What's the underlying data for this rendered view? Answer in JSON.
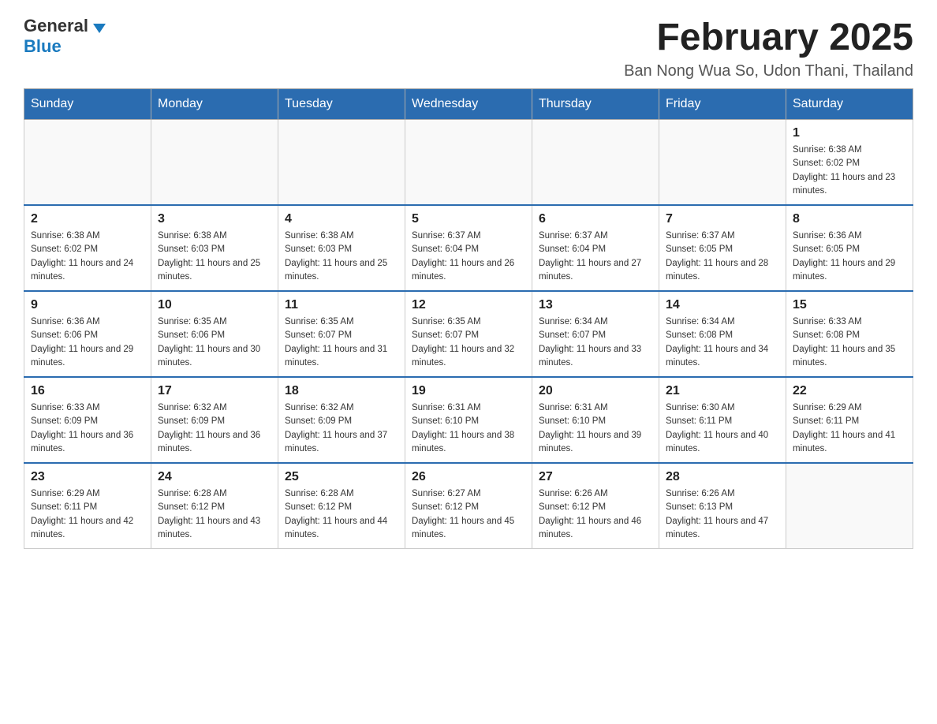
{
  "header": {
    "logo_general": "General",
    "logo_blue": "Blue",
    "month_year": "February 2025",
    "location": "Ban Nong Wua So, Udon Thani, Thailand"
  },
  "weekdays": [
    "Sunday",
    "Monday",
    "Tuesday",
    "Wednesday",
    "Thursday",
    "Friday",
    "Saturday"
  ],
  "weeks": [
    [
      {
        "day": "",
        "sunrise": "",
        "sunset": "",
        "daylight": ""
      },
      {
        "day": "",
        "sunrise": "",
        "sunset": "",
        "daylight": ""
      },
      {
        "day": "",
        "sunrise": "",
        "sunset": "",
        "daylight": ""
      },
      {
        "day": "",
        "sunrise": "",
        "sunset": "",
        "daylight": ""
      },
      {
        "day": "",
        "sunrise": "",
        "sunset": "",
        "daylight": ""
      },
      {
        "day": "",
        "sunrise": "",
        "sunset": "",
        "daylight": ""
      },
      {
        "day": "1",
        "sunrise": "Sunrise: 6:38 AM",
        "sunset": "Sunset: 6:02 PM",
        "daylight": "Daylight: 11 hours and 23 minutes."
      }
    ],
    [
      {
        "day": "2",
        "sunrise": "Sunrise: 6:38 AM",
        "sunset": "Sunset: 6:02 PM",
        "daylight": "Daylight: 11 hours and 24 minutes."
      },
      {
        "day": "3",
        "sunrise": "Sunrise: 6:38 AM",
        "sunset": "Sunset: 6:03 PM",
        "daylight": "Daylight: 11 hours and 25 minutes."
      },
      {
        "day": "4",
        "sunrise": "Sunrise: 6:38 AM",
        "sunset": "Sunset: 6:03 PM",
        "daylight": "Daylight: 11 hours and 25 minutes."
      },
      {
        "day": "5",
        "sunrise": "Sunrise: 6:37 AM",
        "sunset": "Sunset: 6:04 PM",
        "daylight": "Daylight: 11 hours and 26 minutes."
      },
      {
        "day": "6",
        "sunrise": "Sunrise: 6:37 AM",
        "sunset": "Sunset: 6:04 PM",
        "daylight": "Daylight: 11 hours and 27 minutes."
      },
      {
        "day": "7",
        "sunrise": "Sunrise: 6:37 AM",
        "sunset": "Sunset: 6:05 PM",
        "daylight": "Daylight: 11 hours and 28 minutes."
      },
      {
        "day": "8",
        "sunrise": "Sunrise: 6:36 AM",
        "sunset": "Sunset: 6:05 PM",
        "daylight": "Daylight: 11 hours and 29 minutes."
      }
    ],
    [
      {
        "day": "9",
        "sunrise": "Sunrise: 6:36 AM",
        "sunset": "Sunset: 6:06 PM",
        "daylight": "Daylight: 11 hours and 29 minutes."
      },
      {
        "day": "10",
        "sunrise": "Sunrise: 6:35 AM",
        "sunset": "Sunset: 6:06 PM",
        "daylight": "Daylight: 11 hours and 30 minutes."
      },
      {
        "day": "11",
        "sunrise": "Sunrise: 6:35 AM",
        "sunset": "Sunset: 6:07 PM",
        "daylight": "Daylight: 11 hours and 31 minutes."
      },
      {
        "day": "12",
        "sunrise": "Sunrise: 6:35 AM",
        "sunset": "Sunset: 6:07 PM",
        "daylight": "Daylight: 11 hours and 32 minutes."
      },
      {
        "day": "13",
        "sunrise": "Sunrise: 6:34 AM",
        "sunset": "Sunset: 6:07 PM",
        "daylight": "Daylight: 11 hours and 33 minutes."
      },
      {
        "day": "14",
        "sunrise": "Sunrise: 6:34 AM",
        "sunset": "Sunset: 6:08 PM",
        "daylight": "Daylight: 11 hours and 34 minutes."
      },
      {
        "day": "15",
        "sunrise": "Sunrise: 6:33 AM",
        "sunset": "Sunset: 6:08 PM",
        "daylight": "Daylight: 11 hours and 35 minutes."
      }
    ],
    [
      {
        "day": "16",
        "sunrise": "Sunrise: 6:33 AM",
        "sunset": "Sunset: 6:09 PM",
        "daylight": "Daylight: 11 hours and 36 minutes."
      },
      {
        "day": "17",
        "sunrise": "Sunrise: 6:32 AM",
        "sunset": "Sunset: 6:09 PM",
        "daylight": "Daylight: 11 hours and 36 minutes."
      },
      {
        "day": "18",
        "sunrise": "Sunrise: 6:32 AM",
        "sunset": "Sunset: 6:09 PM",
        "daylight": "Daylight: 11 hours and 37 minutes."
      },
      {
        "day": "19",
        "sunrise": "Sunrise: 6:31 AM",
        "sunset": "Sunset: 6:10 PM",
        "daylight": "Daylight: 11 hours and 38 minutes."
      },
      {
        "day": "20",
        "sunrise": "Sunrise: 6:31 AM",
        "sunset": "Sunset: 6:10 PM",
        "daylight": "Daylight: 11 hours and 39 minutes."
      },
      {
        "day": "21",
        "sunrise": "Sunrise: 6:30 AM",
        "sunset": "Sunset: 6:11 PM",
        "daylight": "Daylight: 11 hours and 40 minutes."
      },
      {
        "day": "22",
        "sunrise": "Sunrise: 6:29 AM",
        "sunset": "Sunset: 6:11 PM",
        "daylight": "Daylight: 11 hours and 41 minutes."
      }
    ],
    [
      {
        "day": "23",
        "sunrise": "Sunrise: 6:29 AM",
        "sunset": "Sunset: 6:11 PM",
        "daylight": "Daylight: 11 hours and 42 minutes."
      },
      {
        "day": "24",
        "sunrise": "Sunrise: 6:28 AM",
        "sunset": "Sunset: 6:12 PM",
        "daylight": "Daylight: 11 hours and 43 minutes."
      },
      {
        "day": "25",
        "sunrise": "Sunrise: 6:28 AM",
        "sunset": "Sunset: 6:12 PM",
        "daylight": "Daylight: 11 hours and 44 minutes."
      },
      {
        "day": "26",
        "sunrise": "Sunrise: 6:27 AM",
        "sunset": "Sunset: 6:12 PM",
        "daylight": "Daylight: 11 hours and 45 minutes."
      },
      {
        "day": "27",
        "sunrise": "Sunrise: 6:26 AM",
        "sunset": "Sunset: 6:12 PM",
        "daylight": "Daylight: 11 hours and 46 minutes."
      },
      {
        "day": "28",
        "sunrise": "Sunrise: 6:26 AM",
        "sunset": "Sunset: 6:13 PM",
        "daylight": "Daylight: 11 hours and 47 minutes."
      },
      {
        "day": "",
        "sunrise": "",
        "sunset": "",
        "daylight": ""
      }
    ]
  ]
}
